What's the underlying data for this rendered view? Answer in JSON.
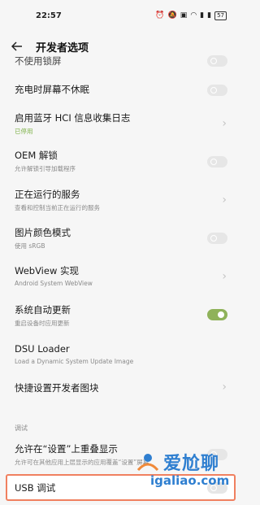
{
  "status_bar": {
    "time": "22:57",
    "battery": "57"
  },
  "header": {
    "title": "开发者选项"
  },
  "rows": [
    {
      "title": "不使用锁屏",
      "control": "toggle",
      "on": false
    },
    {
      "title": "充电时屏幕不休眠",
      "control": "toggle",
      "on": false
    },
    {
      "title": "启用蓝牙 HCI 信息收集日志",
      "subtitle": "已停用",
      "control": "chevron"
    },
    {
      "title": "OEM 解锁",
      "subtitle": "允许解锁引导加载程序",
      "control": "toggle",
      "on": false
    },
    {
      "title": "正在运行的服务",
      "subtitle": "查看和控制当前正在运行的服务",
      "control": "chevron"
    },
    {
      "title": "图片颜色模式",
      "subtitle": "使用 sRGB",
      "control": "toggle",
      "on": false
    },
    {
      "title": "WebView 实现",
      "subtitle": "Android System WebView",
      "control": "chevron"
    },
    {
      "title": "系统自动更新",
      "subtitle": "重启设备时应用更新",
      "control": "toggle",
      "on": true
    },
    {
      "title": "DSU Loader",
      "subtitle": "Load a Dynamic System Update Image",
      "control": "none"
    },
    {
      "title": "快捷设置开发者图块",
      "control": "chevron"
    }
  ],
  "section": {
    "label": "调试"
  },
  "debug_rows": [
    {
      "title": "允许在“设置”上重叠显示",
      "subtitle": "允许可在其他应用上层显示的应用覆盖“设置”屏幕",
      "control": "toggle",
      "on": false
    },
    {
      "title": "USB 调试",
      "control": "toggle",
      "on": false
    }
  ],
  "watermark": {
    "cn": "爱尬聊",
    "url": "igaliao.com"
  }
}
